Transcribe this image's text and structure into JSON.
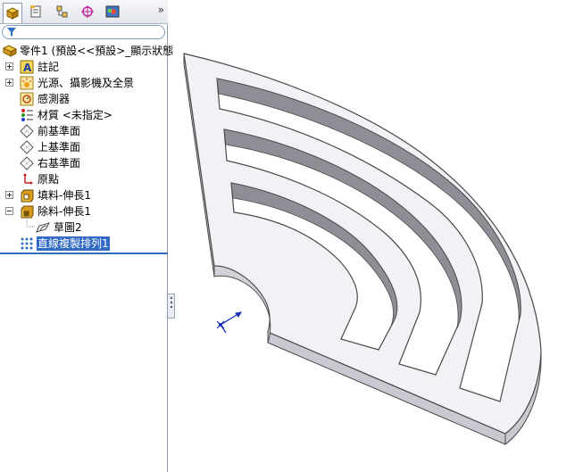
{
  "panel": {
    "tabs": [
      {
        "name": "feature-manager",
        "icon": "feature-tree-icon",
        "active": true
      },
      {
        "name": "property-manager",
        "icon": "property-icon",
        "active": false
      },
      {
        "name": "configuration-manager",
        "icon": "configuration-icon",
        "active": false
      },
      {
        "name": "dimxpert-manager",
        "icon": "crosshair-icon",
        "active": false
      },
      {
        "name": "display-manager",
        "icon": "display-icon",
        "active": false
      }
    ],
    "more_label": "»",
    "filter_icon": "filter-icon"
  },
  "tree": {
    "root": "零件1  (預設<<預設>_顯示狀態",
    "items": [
      {
        "label": "註記",
        "icon": "annotation-icon",
        "expander": "plus"
      },
      {
        "label": "光源、攝影機及全景",
        "icon": "lights-icon",
        "expander": "plus"
      },
      {
        "label": "感測器",
        "icon": "sensor-icon",
        "expander": "none"
      },
      {
        "label": "材質 <未指定>",
        "icon": "material-icon",
        "expander": "none"
      },
      {
        "label": "前基準面",
        "icon": "plane-icon",
        "expander": "none"
      },
      {
        "label": "上基準面",
        "icon": "plane-icon",
        "expander": "none"
      },
      {
        "label": "右基準面",
        "icon": "plane-icon",
        "expander": "none"
      },
      {
        "label": "原點",
        "icon": "origin-icon",
        "expander": "none"
      },
      {
        "label": "填料-伸長1",
        "icon": "boss-extrude-icon",
        "expander": "plus"
      },
      {
        "label": "除料-伸長1",
        "icon": "cut-extrude-icon",
        "expander": "minus"
      },
      {
        "label": "草圖2",
        "icon": "sketch-icon",
        "expander": "none"
      },
      {
        "label": "直線複製排列1",
        "icon": "linear-pattern-icon",
        "expander": "none",
        "selected": true
      }
    ]
  },
  "colors": {
    "selection": "#316ac5",
    "part_face": "#f1f1f6",
    "part_side": "#c9c9d1",
    "part_edge": "#4a4a4a",
    "triad": "#1b2fb5"
  }
}
